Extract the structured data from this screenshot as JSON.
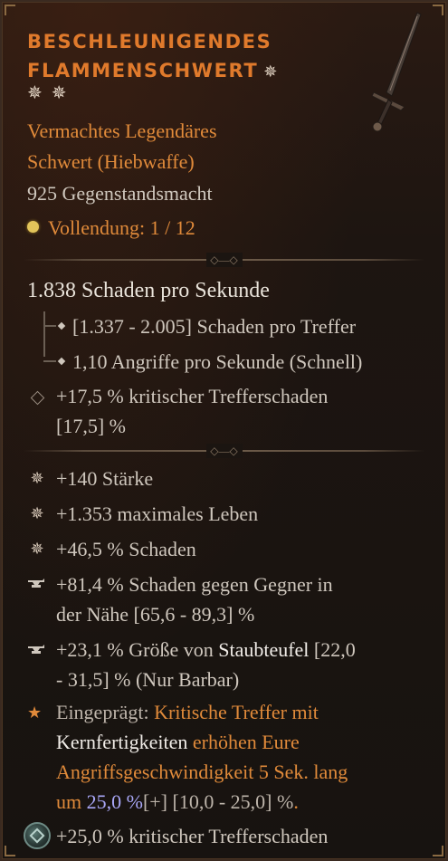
{
  "item": {
    "name_line1": "BESCHLEUNIGENDES",
    "name_line2": "FLAMMENSCHWERT",
    "type_line1": "Vermachtes Legendäres",
    "type_line2": "Schwert (Hiebwaffe)",
    "item_power": "925 Gegenstandsmacht",
    "mastery_label": "Vollendung: 1 / 12"
  },
  "stats": {
    "dps": "1.838 Schaden pro Sekunde",
    "damage_per_hit": "[1.337 - 2.005] Schaden pro Treffer",
    "attacks_per_second": "1,10 Angriffe pro Sekunde (Schnell)",
    "crit_damage_line1": "+17,5 % kritischer Trefferschaden",
    "crit_damage_line2": "[17,5] %"
  },
  "affixes": [
    {
      "icon": "greater-affix-star-icon",
      "text": "+140 Stärke"
    },
    {
      "icon": "greater-affix-star-icon",
      "text": "+1.353 maximales Leben"
    },
    {
      "icon": "greater-affix-star-icon",
      "text": "+46,5 % Schaden"
    },
    {
      "icon": "tempered-anvil-icon",
      "line1": "+81,4 % Schaden gegen Gegner in",
      "line2": "der Nähe [65,6 - 89,3] %"
    },
    {
      "icon": "tempered-anvil-icon",
      "line1_pre": "+23,1 % Größe von ",
      "line1_skill": "Staubteufel",
      "line1_post": " [22,0",
      "line2": "- 31,5] % (Nur Barbar)"
    }
  ],
  "imprint": {
    "icon": "legendary-star-icon",
    "label": "Eingeprägt:",
    "text_a": " Kritische Treffer mit",
    "text_b": "Kernfertigkeiten",
    "text_c": " erhöhen Eure",
    "text_d": "Angriffsgeschwindigkeit 5 Sek. lang",
    "text_e": "um ",
    "value": "25,0 %",
    "range": "[+] [10,0 - 25,0] %",
    "end": "."
  },
  "socket": {
    "icon": "socketed-gem-icon",
    "text": "+25,0 % kritischer Trefferschaden"
  },
  "colors": {
    "title_orange": "#e07a2c",
    "legendary_orange": "#e08a3a",
    "body_text": "#cfc7bd",
    "value_blue": "#a9a7f7",
    "mastery_gold": "#e2c45a"
  }
}
